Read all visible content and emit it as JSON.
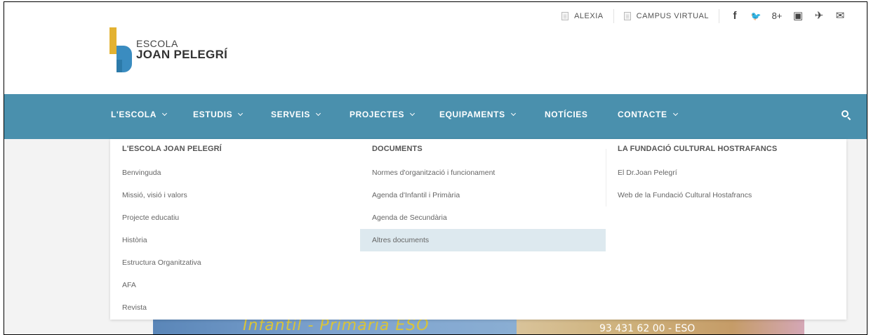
{
  "topbar": {
    "links": [
      {
        "label": "ALEXIA"
      },
      {
        "label": "CAMPUS VIRTUAL"
      }
    ],
    "social": [
      {
        "icon": "facebook-icon",
        "glyph": "f"
      },
      {
        "icon": "twitter-icon",
        "glyph": "🐦"
      },
      {
        "icon": "google-plus-icon",
        "glyph": "8+"
      },
      {
        "icon": "youtube-icon",
        "glyph": "▣"
      },
      {
        "icon": "plane-icon",
        "glyph": "✈"
      },
      {
        "icon": "mail-icon",
        "glyph": "✉"
      }
    ]
  },
  "logo": {
    "line1": "ESCOLA",
    "line2": "JOAN PELEGRÍ"
  },
  "nav": {
    "items": [
      {
        "label": "L'ESCOLA",
        "has_dropdown": true
      },
      {
        "label": "ESTUDIS",
        "has_dropdown": true
      },
      {
        "label": "SERVEIS",
        "has_dropdown": true
      },
      {
        "label": "PROJECTES",
        "has_dropdown": true
      },
      {
        "label": "EQUIPAMENTS",
        "has_dropdown": true
      },
      {
        "label": "NOTÍCIES",
        "has_dropdown": false
      },
      {
        "label": "CONTACTE",
        "has_dropdown": true
      }
    ]
  },
  "dropdown": {
    "columns": [
      {
        "heading": "L'ESCOLA JOAN PELEGRÍ",
        "items": [
          "Benvinguda",
          "Missió, visió i valors",
          "Projecte educatiu",
          "Història",
          "Estructura Organitzativa",
          "AFA",
          "Revista"
        ]
      },
      {
        "heading": "DOCUMENTS",
        "items": [
          "Normes d'organització i funcionament",
          "Agenda d'Infantil i Primària",
          "Agenda de Secundària",
          "Altres documents"
        ],
        "active_index": 3
      },
      {
        "heading": "LA FUNDACIÓ CULTURAL HOSTRAFANCS",
        "items": [
          "El Dr.Joan Pelegrí",
          "Web de la Fundació Cultural Hostafrancs"
        ]
      }
    ]
  },
  "banner": {
    "text": "Infantil  -  Primària   ESO",
    "phone": "93 431 62 00 - ESO"
  },
  "colors": {
    "nav_bg": "#4a90ad",
    "active_item_bg": "#dde9ef",
    "logo_yellow": "#e3b232",
    "logo_blue": "#3a8cc0"
  }
}
